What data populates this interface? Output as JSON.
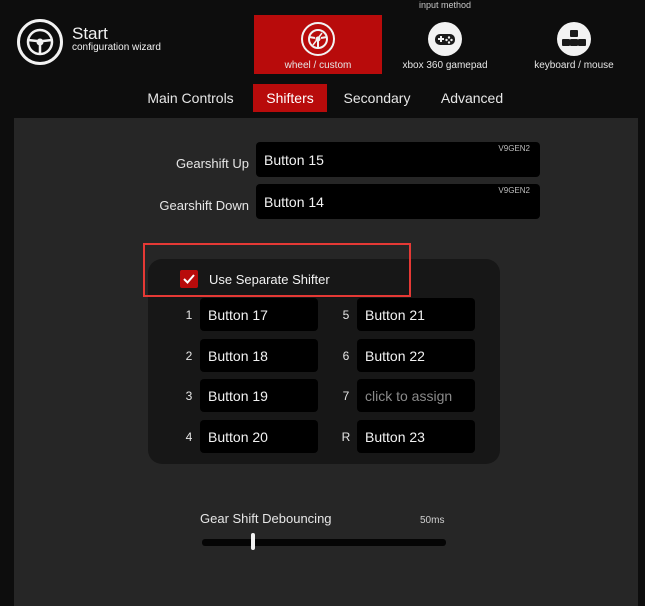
{
  "header": {
    "title": "Start",
    "subtitle": "configuration wizard",
    "input_method_label": "input method",
    "methods": [
      {
        "label": "wheel / custom",
        "icon": "steering-wheel-icon",
        "selected": true
      },
      {
        "label": "xbox 360 gamepad",
        "icon": "gamepad-icon",
        "selected": false
      },
      {
        "label": "keyboard / mouse",
        "icon": "keyboard-icon",
        "selected": false
      }
    ]
  },
  "tabs": [
    {
      "label": "Main Controls",
      "active": false
    },
    {
      "label": "Shifters",
      "active": true
    },
    {
      "label": "Secondary",
      "active": false
    },
    {
      "label": "Advanced",
      "active": false
    }
  ],
  "gearshift": {
    "up_label": "Gearshift Up",
    "up_value": "Button 15",
    "up_device": "V9GEN2",
    "down_label": "Gearshift Down",
    "down_value": "Button 14",
    "down_device": "V9GEN2"
  },
  "separate_shifter": {
    "label": "Use Separate Shifter",
    "checked": true,
    "gears": [
      {
        "num": "1",
        "value": "Button 17"
      },
      {
        "num": "5",
        "value": "Button 21"
      },
      {
        "num": "2",
        "value": "Button 18"
      },
      {
        "num": "6",
        "value": "Button 22"
      },
      {
        "num": "3",
        "value": "Button 19"
      },
      {
        "num": "7",
        "value": "click to assign"
      },
      {
        "num": "4",
        "value": "Button 20"
      },
      {
        "num": "R",
        "value": "Button 23"
      }
    ]
  },
  "debouncing": {
    "label": "Gear Shift Debouncing",
    "value_text": "50ms",
    "fraction": 0.21
  },
  "colors": {
    "accent": "#b80b0b",
    "highlight_border": "#e53935",
    "background": "#0d0d0d",
    "panel": "#262626"
  }
}
